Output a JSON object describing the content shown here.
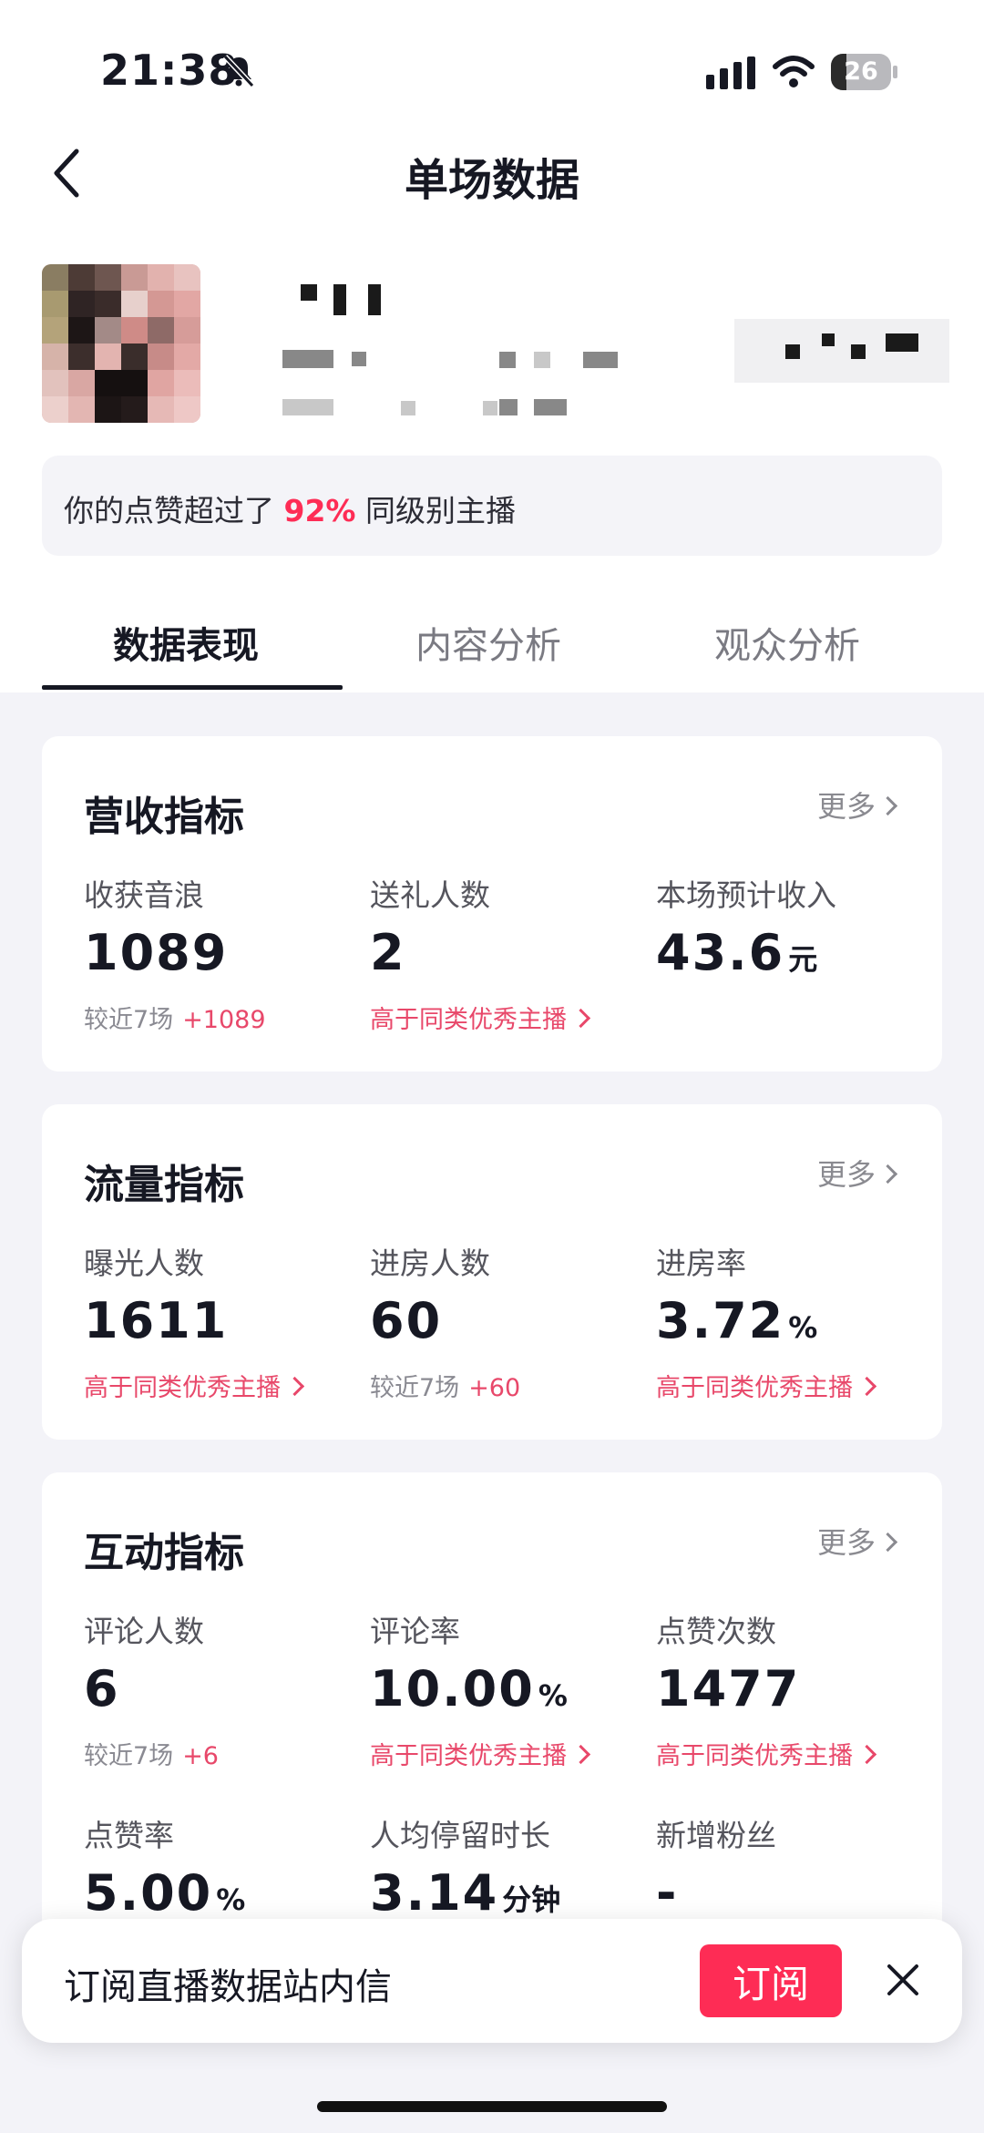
{
  "status_bar": {
    "time": "21:38",
    "battery": "26",
    "battery_level": 0.26
  },
  "header": {
    "title": "单场数据"
  },
  "banner": {
    "prefix": "你的点赞超过了 ",
    "percent": "92%",
    "suffix": " 同级别主播"
  },
  "tabs": [
    "数据表现",
    "内容分析",
    "观众分析"
  ],
  "more_label": "更多",
  "revenue": {
    "title": "营收指标",
    "metrics": [
      {
        "label": "收获音浪",
        "value": "1089",
        "unit": "",
        "sub": "较近7场",
        "delta": "+1089"
      },
      {
        "label": "送礼人数",
        "value": "2",
        "unit": "",
        "sub": "高于同类优秀主播"
      },
      {
        "label": "本场预计收入",
        "value": "43.6",
        "unit": "元",
        "sub": ""
      }
    ]
  },
  "traffic": {
    "title": "流量指标",
    "metrics": [
      {
        "label": "曝光人数",
        "value": "1611",
        "unit": "",
        "sub": "高于同类优秀主播"
      },
      {
        "label": "进房人数",
        "value": "60",
        "unit": "",
        "sub": "较近7场",
        "delta": "+60"
      },
      {
        "label": "进房率",
        "value": "3.72",
        "unit": "%",
        "sub": "高于同类优秀主播"
      }
    ]
  },
  "interaction": {
    "title": "互动指标",
    "metrics": [
      {
        "label": "评论人数",
        "value": "6",
        "unit": "",
        "sub": "较近7场",
        "delta": "+6"
      },
      {
        "label": "评论率",
        "value": "10.00",
        "unit": "%",
        "sub": "高于同类优秀主播"
      },
      {
        "label": "点赞次数",
        "value": "1477",
        "unit": "",
        "sub": "高于同类优秀主播"
      },
      {
        "label": "点赞率",
        "value": "5.00",
        "unit": "%"
      },
      {
        "label": "人均停留时长",
        "value": "3.14",
        "unit": "分钟"
      },
      {
        "label": "新增粉丝",
        "value": "-",
        "unit": ""
      }
    ]
  },
  "popup": {
    "text": "订阅直播数据站内信",
    "button": "订阅"
  }
}
